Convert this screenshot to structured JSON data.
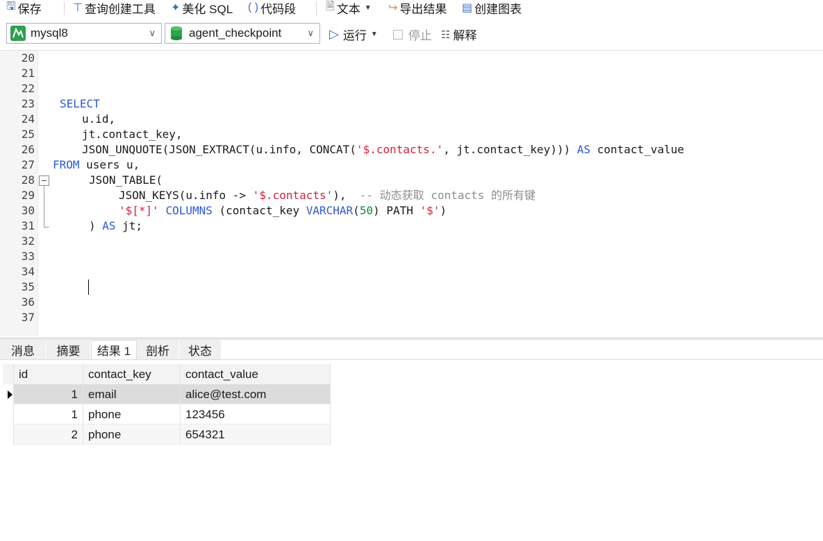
{
  "toolbar": {
    "save": "保存",
    "query_builder": "查询创建工具",
    "beautify": "美化 SQL",
    "snippet": "代码段",
    "text": "文本",
    "export": "导出结果",
    "chart": "创建图表"
  },
  "toolbar2": {
    "connection": "mysql8",
    "database": "agent_checkpoint",
    "run": "运行",
    "stop": "停止",
    "explain": "解释"
  },
  "editor": {
    "line_numbers": [
      "20",
      "21",
      "22",
      "23",
      "24",
      "25",
      "26",
      "27",
      "28",
      "29",
      "30",
      "31",
      "32",
      "33",
      "34",
      "35",
      "36",
      "37"
    ]
  },
  "results": {
    "tabs": [
      "消息",
      "摘要",
      "结果 1",
      "剖析",
      "状态"
    ],
    "active_tab": "结果 1",
    "columns": [
      "id",
      "contact_key",
      "contact_value"
    ],
    "rows": [
      {
        "id": "1",
        "contact_key": "email",
        "contact_value": "alice@test.com"
      },
      {
        "id": "1",
        "contact_key": "phone",
        "contact_value": "123456"
      },
      {
        "id": "2",
        "contact_key": "phone",
        "contact_value": "654321"
      }
    ]
  },
  "colors": {
    "keyword": "#2b57d6",
    "string": "#d2223d",
    "number": "#118a3a",
    "comment": "#8c8c8c",
    "selected_row": "#dcdcdc"
  }
}
